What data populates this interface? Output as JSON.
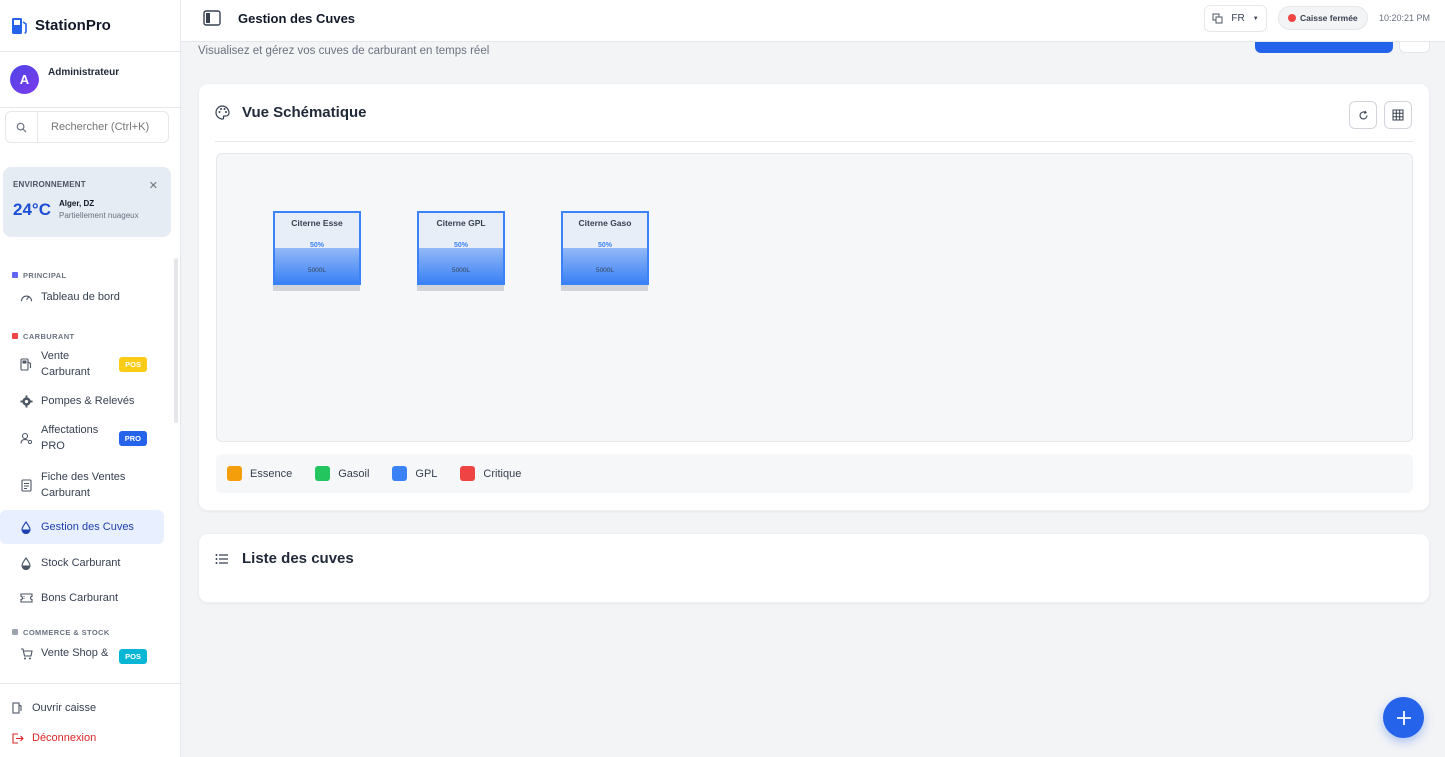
{
  "brand": {
    "name": "StationPro"
  },
  "user": {
    "initial": "A",
    "name": "Administrateur"
  },
  "search": {
    "placeholder": "Rechercher (Ctrl+K)"
  },
  "environment": {
    "title": "ENVIRONNEMENT",
    "temperature": "24°C",
    "city": "Alger, DZ",
    "description": "Partiellement nuageux"
  },
  "nav": {
    "sections": [
      {
        "label": "PRINCIPAL",
        "color": "#6366f1"
      },
      {
        "label": "CARBURANT",
        "color": "#ef4444"
      },
      {
        "label": "COMMERCE & STOCK",
        "color": "#9ca3af"
      }
    ],
    "items": [
      {
        "label": "Tableau de bord"
      },
      {
        "label_line1": "Vente",
        "label_line2": "Carburant",
        "badge": "POS"
      },
      {
        "label": "Pompes & Relevés"
      },
      {
        "label_line1": "Affectations",
        "label_line2": "PRO",
        "badge": "PRO"
      },
      {
        "label_line1": "Fiche des Ventes",
        "label_line2": "Carburant"
      },
      {
        "label": "Gestion des Cuves",
        "active": true
      },
      {
        "label": "Stock Carburant"
      },
      {
        "label": "Bons Carburant"
      },
      {
        "label": "Vente Shop &",
        "badge": "POS"
      }
    ]
  },
  "footer": {
    "open_register": "Ouvrir caisse",
    "logout": "Déconnexion"
  },
  "topbar": {
    "title": "Gestion des Cuves",
    "language": "FR",
    "register_status": "Caisse fermée",
    "time": "10:20:21 PM"
  },
  "page": {
    "subtitle": "Visualisez et gérez vos cuves de carburant en temps réel"
  },
  "schema": {
    "title": "Vue Schématique",
    "tanks": [
      {
        "name": "Citerne Esse",
        "level_pct": 50,
        "level_label": "50%",
        "capacity": "5000L"
      },
      {
        "name": "Citerne GPL",
        "level_pct": 50,
        "level_label": "50%",
        "capacity": "5000L"
      },
      {
        "name": "Citerne Gaso",
        "level_pct": 50,
        "level_label": "50%",
        "capacity": "5000L"
      }
    ],
    "legend": [
      {
        "label": "Essence",
        "color": "#f59e0b"
      },
      {
        "label": "Gasoil",
        "color": "#22c55e"
      },
      {
        "label": "GPL",
        "color": "#3b82f6"
      },
      {
        "label": "Critique",
        "color": "#ef4444"
      }
    ]
  },
  "list": {
    "title": "Liste des cuves"
  },
  "colors": {
    "primary": "#2563eb",
    "tank_border": "#3b82f6"
  }
}
